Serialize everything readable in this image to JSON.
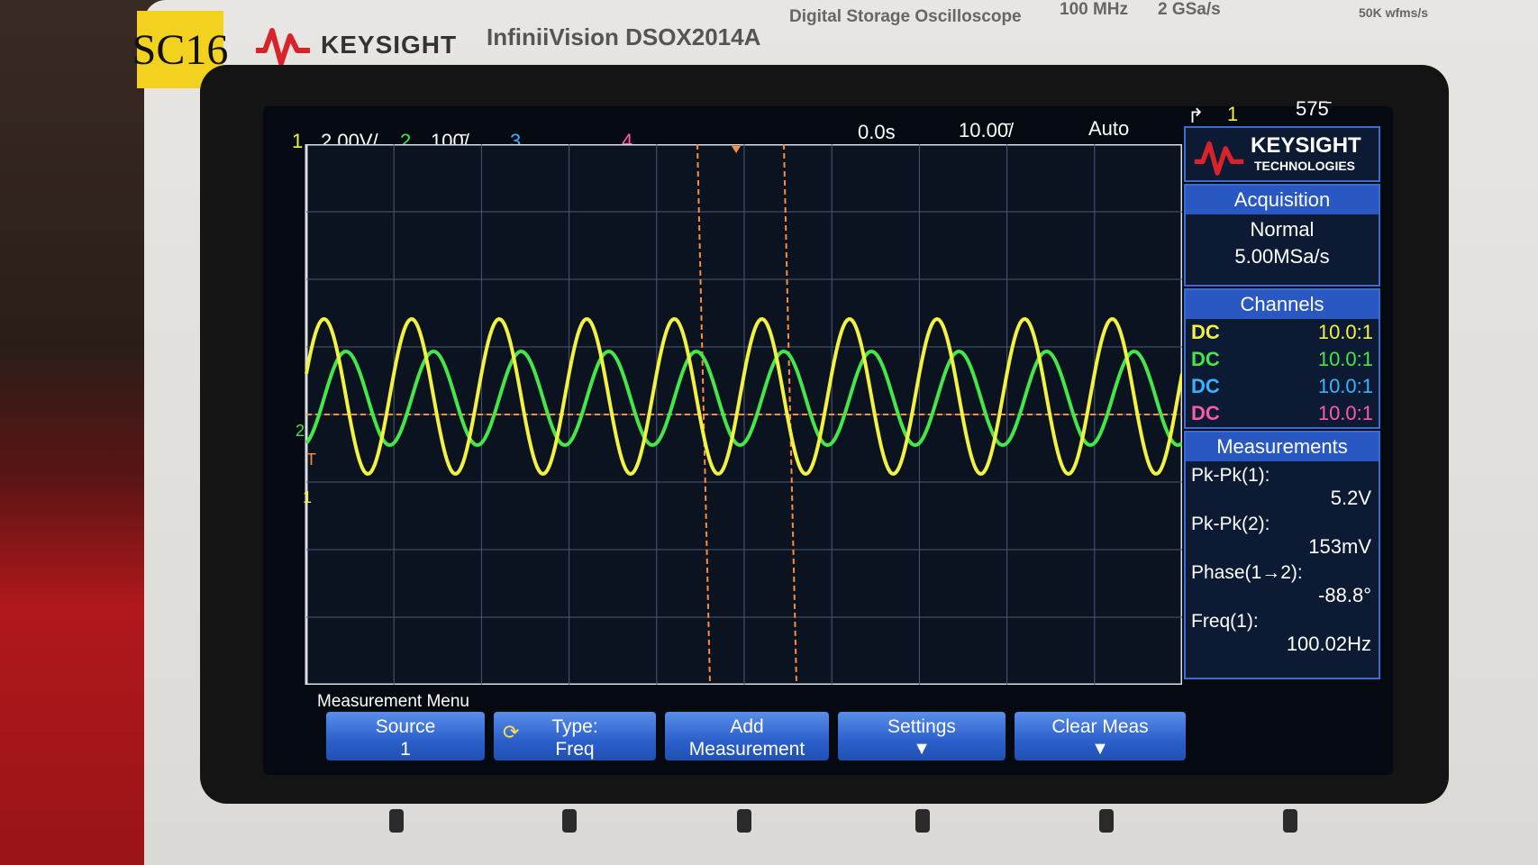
{
  "label": {
    "tag": "SC16"
  },
  "instrument": {
    "brand": "KEYSIGHT",
    "model": "InfiniiVision DSOX2014A",
    "description": "Digital Storage Oscilloscope",
    "bandwidth": "100 MHz",
    "sample_rate": "2 GSa/s",
    "wfm_rate": "50K wfms/s"
  },
  "status_bar": {
    "ch1_num": "1",
    "ch1_scale": "2.00V/",
    "ch2_num": "2",
    "ch2_scale": "100̄/",
    "ch3_num": "3",
    "ch4_num": "4",
    "time_delay": "0.0s",
    "time_scale": "10.00̄/",
    "trigger_mode": "Auto",
    "trigger_source": "1",
    "trigger_level": "575̄"
  },
  "side_panel": {
    "logo_line1": "KEYSIGHT",
    "logo_line2": "TECHNOLOGIES",
    "acquisition": {
      "title": "Acquisition",
      "mode": "Normal",
      "rate": "5.00MSa/s"
    },
    "channels": {
      "title": "Channels",
      "rows": [
        {
          "coupling": "DC",
          "probe": "10.0:1",
          "color": "#f2f244"
        },
        {
          "coupling": "DC",
          "probe": "10.0:1",
          "color": "#44e64a"
        },
        {
          "coupling": "DC",
          "probe": "10.0:1",
          "color": "#3ab2ff"
        },
        {
          "coupling": "DC",
          "probe": "10.0:1",
          "color": "#ff5aa8"
        }
      ]
    },
    "measurements": {
      "title": "Measurements",
      "items": [
        {
          "label": "Pk-Pk(1):",
          "value": "5.2V"
        },
        {
          "label": "Pk-Pk(2):",
          "value": "153mV"
        },
        {
          "label": "Phase(1→2):",
          "value": "-88.8°"
        },
        {
          "label": "Freq(1):",
          "value": "100.02Hz"
        }
      ]
    }
  },
  "menu": {
    "title": "Measurement Menu",
    "softkeys": [
      {
        "line1": "Source",
        "line2": "1"
      },
      {
        "line1": "Type:",
        "line2": "Freq"
      },
      {
        "line1": "Add",
        "line2": "Measurement"
      },
      {
        "line1": "Settings",
        "line2": ""
      },
      {
        "line1": "Clear Meas",
        "line2": ""
      }
    ]
  },
  "ground_markers": {
    "ch2": "2",
    "trigger": "T",
    "ch1": "1"
  },
  "colors": {
    "ch1": "#f2f244",
    "ch2": "#44e64a",
    "ch3": "#3ab2ff",
    "ch4": "#ff5aa8",
    "cursor": "#ff8c3a",
    "accent": "#2a58c2"
  }
}
